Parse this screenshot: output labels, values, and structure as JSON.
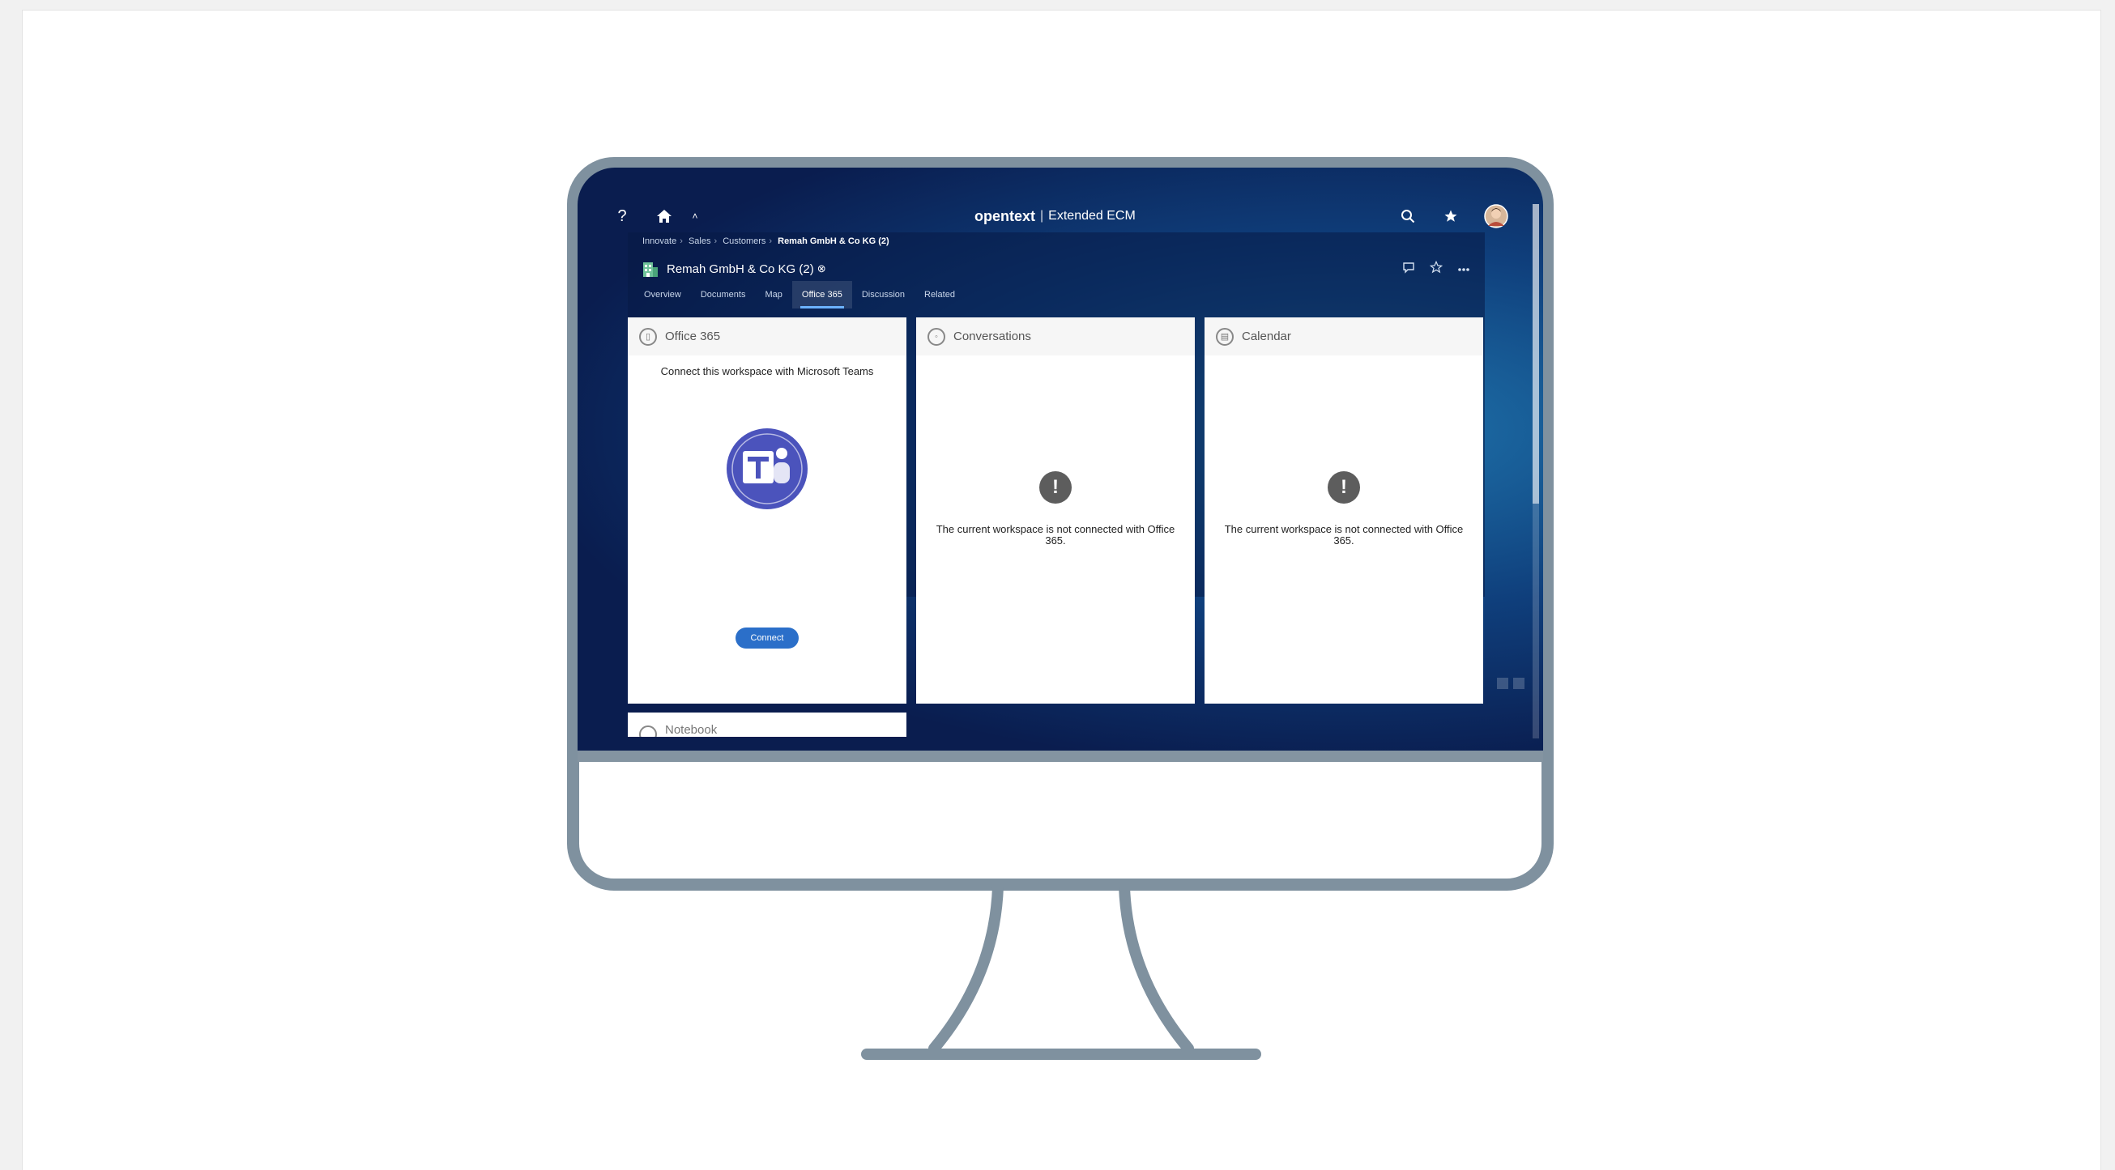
{
  "app": {
    "brand_logo": "opentext",
    "brand_divider": "|",
    "brand_product": "Extended ECM"
  },
  "topbar": {
    "help_icon": "?",
    "home_icon": "home-icon",
    "collapse_icon": "chevron-up-icon",
    "search_icon": "search-icon",
    "favorites_icon": "star-icon",
    "avatar": "user-avatar"
  },
  "breadcrumb": {
    "items": [
      "Innovate",
      "Sales",
      "Customers",
      "Remah GmbH & Co KG (2)"
    ]
  },
  "workspace": {
    "title": "Remah GmbH & Co KG (2)",
    "title_badge": "⊗",
    "actions": [
      "comment-icon",
      "star-outline-icon",
      "more-icon"
    ]
  },
  "tabs": [
    "Overview",
    "Documents",
    "Map",
    "Office 365",
    "Discussion",
    "Related"
  ],
  "active_tab": "Office 365",
  "cards": {
    "office365": {
      "title": "Office 365",
      "message": "Connect this workspace with Microsoft Teams",
      "button": "Connect"
    },
    "conversations": {
      "title": "Conversations",
      "message": "The current workspace is not connected with Office 365."
    },
    "calendar": {
      "title": "Calendar",
      "message": "The current workspace is not connected with Office 365."
    },
    "notebook": {
      "title": "Notebook"
    }
  },
  "colors": {
    "teams_purple": "#4b53bc",
    "connect_button": "#2b6fc9",
    "monitor_frame": "#7f919f"
  }
}
